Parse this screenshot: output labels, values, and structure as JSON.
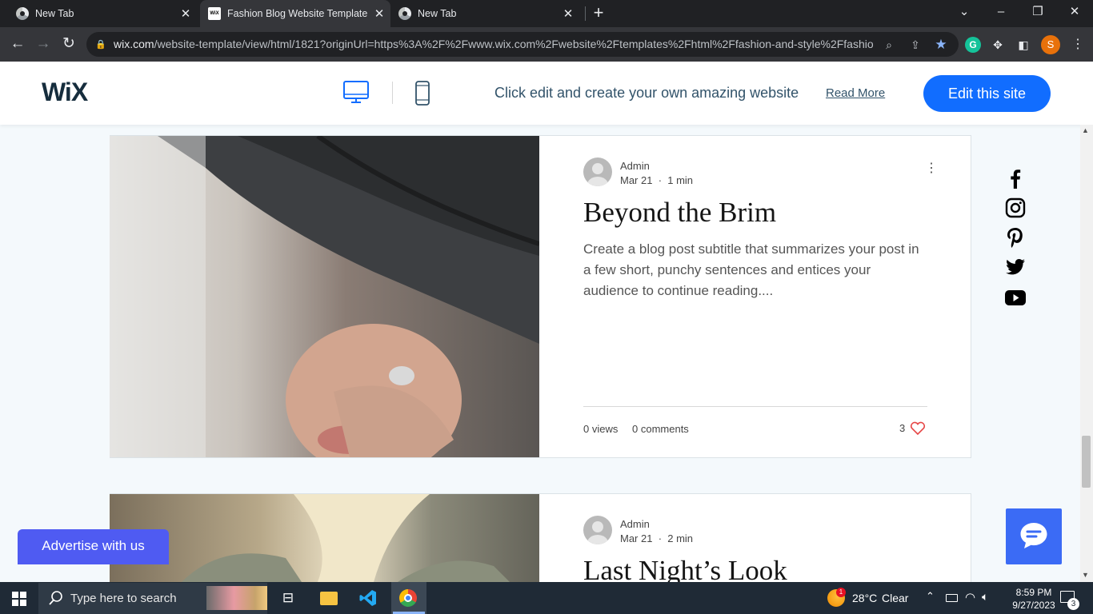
{
  "browser": {
    "tabs": [
      {
        "title": "New Tab",
        "active": false
      },
      {
        "title": "Fashion Blog Website Template |",
        "active": true
      },
      {
        "title": "New Tab",
        "active": false
      }
    ],
    "url_host": "wix.com",
    "url_rest": "/website-template/view/html/1821?originUrl=https%3A%2F%2Fwww.wix.com%2Fwebsite%2Ftemplates%2Fhtml%2Ffashion-and-style%2Ffashio...",
    "profile_initial": "S"
  },
  "wix_header": {
    "logo": "WiX",
    "promo_text": "Click edit and create your own amazing website",
    "read_more": "Read More",
    "edit_button": "Edit this site"
  },
  "posts": [
    {
      "author": "Admin",
      "date": "Mar 21",
      "read_time": "1 min",
      "title": "Beyond the Brim",
      "subtitle": "Create a blog post subtitle that summarizes your post in a few short, punchy sentences and entices your audience to continue reading....",
      "views": "0 views",
      "comments": "0 comments",
      "likes": "3"
    },
    {
      "author": "Admin",
      "date": "Mar 21",
      "read_time": "2 min",
      "title": "Last Night’s Look"
    }
  ],
  "social": [
    "facebook-icon",
    "instagram-icon",
    "pinterest-icon",
    "twitter-icon",
    "youtube-icon"
  ],
  "advertise": "Advertise with us",
  "taskbar": {
    "search_placeholder": "Type here to search",
    "weather_temp": "28°C",
    "weather_desc": "Clear",
    "time": "8:59 PM",
    "date": "9/27/2023",
    "notif_count": "3",
    "weather_badge": "1"
  },
  "colors": {
    "accent": "#116dff",
    "advertise": "#4f5bf2",
    "chat": "#3b6bf5",
    "like": "#e64545"
  }
}
